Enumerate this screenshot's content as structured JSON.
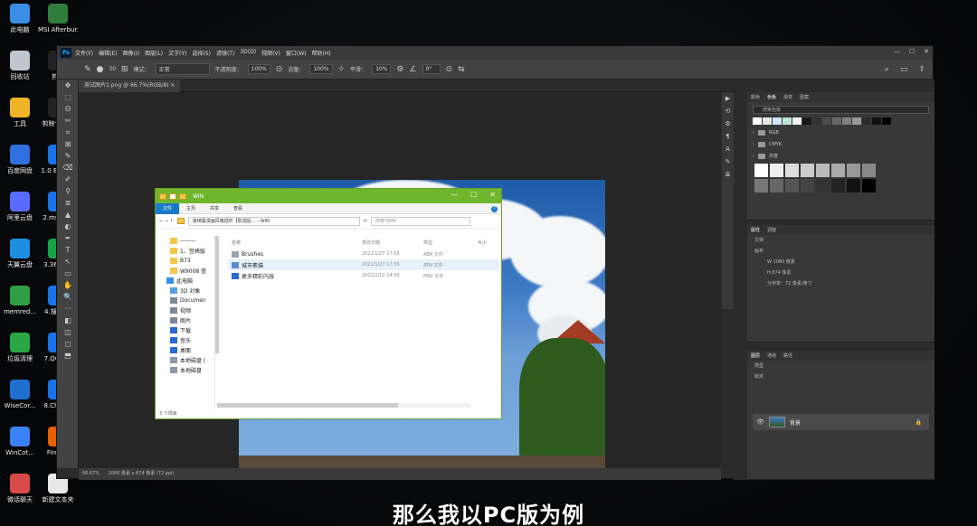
{
  "desktop": {
    "icons": [
      {
        "label": "此电脑",
        "color": "#3a8ee6"
      },
      {
        "label": "MSI Afterbur...",
        "color": "#2f7d3a"
      },
      {
        "label": "回收站",
        "color": "#bfc6cf"
      },
      {
        "label": "剪映",
        "color": "#222222"
      },
      {
        "label": "工具",
        "color": "#f0b429"
      },
      {
        "label": "剪映专业版",
        "color": "#222222"
      },
      {
        "label": "百度网盘",
        "color": "#2f6fe0"
      },
      {
        "label": "1.0 Brow...",
        "color": "#1a73e8"
      },
      {
        "label": "阿里云盘",
        "color": "#5a6cff"
      },
      {
        "label": "2.ms 谷歌",
        "color": "#1a73e8"
      },
      {
        "label": "天翼云盘",
        "color": "#1c8fe3"
      },
      {
        "label": "3.36 浏览",
        "color": "#16a34a"
      },
      {
        "label": "memred...",
        "color": "#2f9e44"
      },
      {
        "label": "4.搜 浏览",
        "color": "#1a73e8"
      },
      {
        "label": "垃圾清理",
        "color": "#29a745"
      },
      {
        "label": "7.QQ (Tri",
        "color": "#1a73e8"
      },
      {
        "label": "WiseCor...",
        "color": "#1f6fd0"
      },
      {
        "label": "8.Ch dev",
        "color": "#1a73e8"
      },
      {
        "label": "WinCot...",
        "color": "#3b82f6"
      },
      {
        "label": "Firef 内",
        "color": "#e66000"
      },
      {
        "label": "微话聊天",
        "color": "#d94a4a"
      },
      {
        "label": "新建文本夹",
        "color": "#e8e8e8"
      }
    ]
  },
  "photoshop": {
    "logo": "Ps",
    "menu": [
      "文件(F)",
      "编辑(E)",
      "图像(I)",
      "图层(L)",
      "文字(Y)",
      "选择(S)",
      "滤镜(T)",
      "3D(D)",
      "视图(V)",
      "窗口(W)",
      "帮助(H)"
    ],
    "win_buttons": [
      "—",
      "☐",
      "✕"
    ],
    "options": {
      "mode_label": "模式：",
      "mode_value": "正常",
      "opacity_label": "不透明度：",
      "opacity_value": "100%",
      "flow_label": "流量：",
      "flow_value": "100%",
      "smooth_label": "平滑：",
      "smooth_value": "10%",
      "angle_value": "0°",
      "brush_size": "30"
    },
    "doc_tab": "测试图片1.png @ 66.7%(RGB/8) ×",
    "tools": [
      "✥",
      "⬚",
      "ʘ",
      "✂",
      "⌗",
      "⊠",
      "✎",
      "⌫",
      "✐",
      "⚲",
      "≣",
      "▲",
      "◐",
      "✒",
      "T",
      "↖",
      "▭",
      "✋",
      "🔍",
      "···",
      "◧",
      "◫",
      "◻",
      "⬒"
    ],
    "status": {
      "zoom": "66.67%",
      "dims": "1080 像素 x 874 像素 (72 ppi)"
    },
    "right_icons": [
      "▶",
      "⟲",
      "⚙",
      "¶",
      "A",
      "✎",
      "≣"
    ],
    "swatches_panel": {
      "tabs": [
        "颜色",
        "色板",
        "渐变",
        "图案"
      ],
      "search_placeholder": "搜索色板",
      "swatch_colors": [
        "#ffffff",
        "#e6e6e6",
        "#cfe8ff",
        "#bfe6d3",
        "#f2f2f2",
        "#1a1a1a",
        "#333333",
        "#4d4d4d",
        "#666666",
        "#808080",
        "#999999",
        "#2d2d2d",
        "#111111",
        "#000000"
      ],
      "groups": [
        "RGB",
        "CMYK",
        "灰度"
      ],
      "grays": [
        "#ffffff",
        "#eeeeee",
        "#dddddd",
        "#cccccc",
        "#bbbbbb",
        "#aaaaaa",
        "#999999",
        "#888888",
        "#777777",
        "#666666",
        "#555555",
        "#444444",
        "#333333",
        "#222222",
        "#111111",
        "#000000"
      ]
    },
    "properties_panel": {
      "tabs": [
        "属性",
        "调整"
      ],
      "doc_label": "文档",
      "canvas_label": "画布",
      "width": "W 1080 像素",
      "height": "H 874 像素",
      "resolution": "分辨率：72 像素/英寸"
    },
    "layers_panel": {
      "tabs": [
        "图层",
        "通道",
        "路径"
      ],
      "kind_label": "类型",
      "lock_label": "锁定",
      "layer_name": "背景"
    }
  },
  "explorer": {
    "title": "WIN",
    "win_buttons": [
      "—",
      "☐",
      "✕"
    ],
    "ribbon": [
      "文件",
      "主页",
      "共享",
      "查看"
    ],
    "help": "?",
    "nav_arrows": "←  →  ↑",
    "address": "宫崎骏漫画风格插件【影视后... › WIN",
    "search_placeholder": "搜索\"WIN\"",
    "columns": {
      "name": "名称",
      "date": "修改日期",
      "type": "类型",
      "size": "大小"
    },
    "files": [
      {
        "name": "Brushes",
        "date": "2021/1/27 17:55",
        "type": "ABR 文件",
        "color": "#9aa5b1",
        "selected": false
      },
      {
        "name": "城市素描",
        "date": "2021/1/27 17:55",
        "type": "ATN 文件",
        "color": "#5b8bd0",
        "selected": true
      },
      {
        "name": "更多精彩内容",
        "date": "2021/1/12 14:59",
        "type": "PNG 文件",
        "color": "#2a6ad2",
        "selected": false
      }
    ],
    "nav": [
      {
        "label": "--------",
        "color": "#f3c74b",
        "lvl": 0
      },
      {
        "label": "1、宫崎骏",
        "color": "#f3c74b",
        "lvl": 0
      },
      {
        "label": "B73",
        "color": "#f3c74b",
        "lvl": 0
      },
      {
        "label": "W9008 查",
        "color": "#f3c74b",
        "lvl": 0
      },
      {
        "label": "此电脑",
        "color": "#3a8ee6",
        "lvl": 1
      },
      {
        "label": "3D 对象",
        "color": "#5aa0e6",
        "lvl": 0
      },
      {
        "label": "Documen",
        "color": "#7a8a9a",
        "lvl": 0
      },
      {
        "label": "视频",
        "color": "#7a8a9a",
        "lvl": 0
      },
      {
        "label": "图片",
        "color": "#7a8a9a",
        "lvl": 0
      },
      {
        "label": "下载",
        "color": "#2a6ad2",
        "lvl": 0
      },
      {
        "label": "音乐",
        "color": "#2a6ad2",
        "lvl": 0
      },
      {
        "label": "桌面",
        "color": "#2a6ad2",
        "lvl": 0
      },
      {
        "label": "本地磁盘 (",
        "color": "#8a9aaa",
        "lvl": 0
      },
      {
        "label": "本地磁盘",
        "color": "#8a9aaa",
        "lvl": 0
      }
    ],
    "status": "3 个项目"
  },
  "subtitle": "那么我以PC版为例"
}
